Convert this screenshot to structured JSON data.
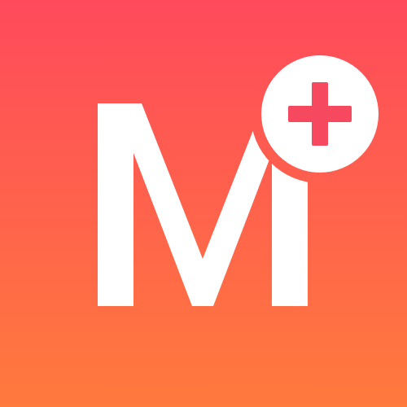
{
  "logo": {
    "letter": "M",
    "badge_symbol": "+",
    "colors": {
      "gradient_top": "#FF4A5C",
      "gradient_bottom": "#FF7A3D",
      "letter": "#FFFFFF",
      "badge_fill": "#FFFFFF",
      "badge_plus": "#F6485F"
    }
  }
}
